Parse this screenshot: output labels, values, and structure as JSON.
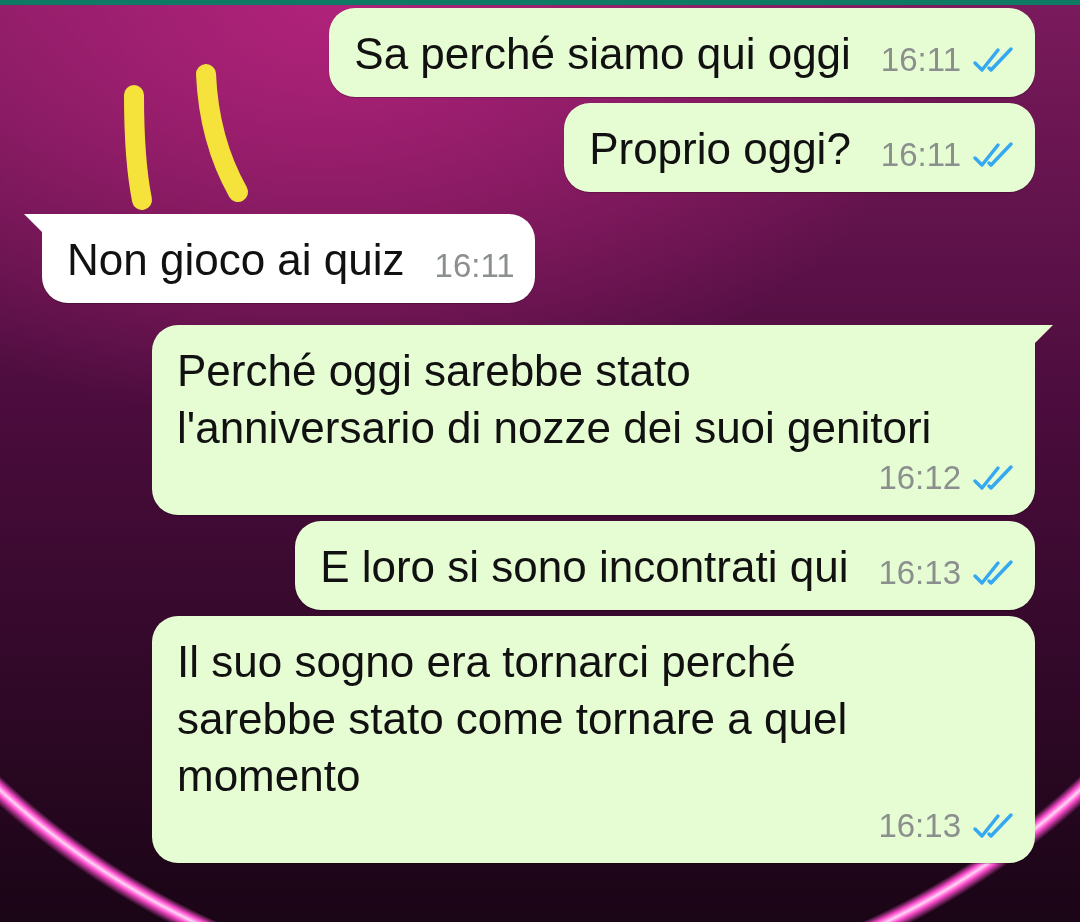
{
  "messages": [
    {
      "kind": "outgoing",
      "text": "Sa perché siamo qui oggi",
      "time": "16:11",
      "read": true
    },
    {
      "kind": "outgoing",
      "text": "Proprio oggi?",
      "time": "16:11",
      "read": true
    },
    {
      "kind": "incoming",
      "text": "Non gioco ai quiz",
      "time": "16:11",
      "tail": true
    },
    {
      "kind": "outgoing",
      "text": "Perché oggi sarebbe stato l'anniversario di nozze dei suoi genitori",
      "time": "16:12",
      "read": true,
      "tail": true
    },
    {
      "kind": "outgoing",
      "text": "E loro si sono incontrati qui",
      "time": "16:13",
      "read": true
    },
    {
      "kind": "outgoing",
      "text": "Il suo sogno era tornarci perché sarebbe stato come tornare a quel momento",
      "time": "16:13",
      "read": true
    }
  ]
}
